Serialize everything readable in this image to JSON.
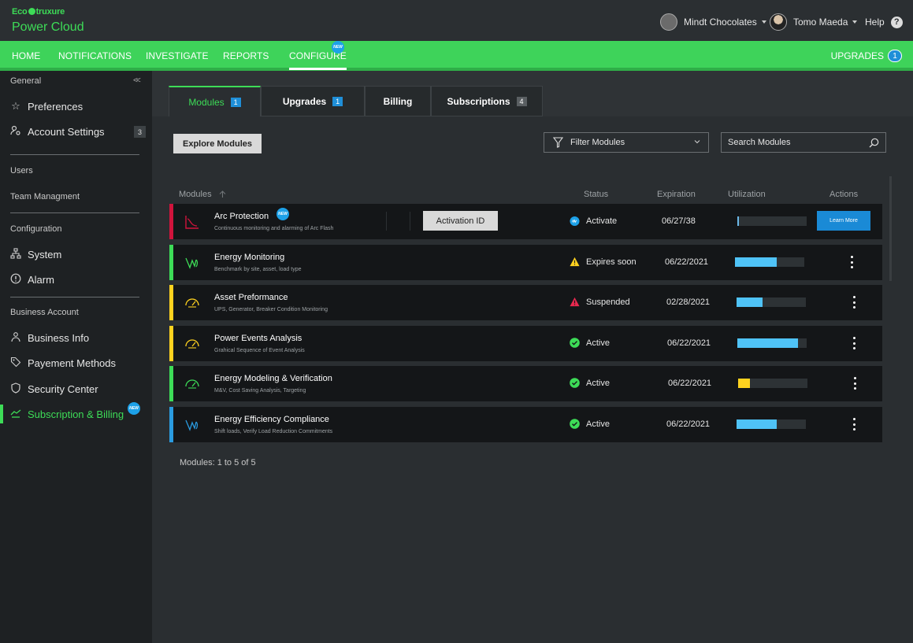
{
  "brand": {
    "eco_prefix": "Eco",
    "eco_suffix": "truxure",
    "title": "Power Cloud"
  },
  "header": {
    "account": "Mindt Chocolates",
    "user": "Tomo Maeda",
    "help": "Help",
    "help_glyph": "?"
  },
  "nav": {
    "items": [
      "HOME",
      "NOTIFICATIONS",
      "INVESTIGATE",
      "REPORTS",
      "CONFIGURE"
    ],
    "active": "CONFIGURE",
    "new_badge": "NEW",
    "upgrades_label": "UPGRADES",
    "upgrades_count": "1"
  },
  "sidebar": {
    "sections": [
      "General",
      "Users",
      "Team Managment",
      "Configuration",
      "Business Account"
    ],
    "items": {
      "preferences": "Preferences",
      "account_settings": "Account Settings",
      "account_settings_count": "3",
      "system": "System",
      "alarm": "Alarm",
      "business_info": "Business Info",
      "payment_methods": "Payement Methods",
      "security_center": "Security Center",
      "subscription_billing": "Subscription & Billing"
    },
    "new_badge": "NEW"
  },
  "tabs": [
    {
      "label": "Modules",
      "count": "1"
    },
    {
      "label": "Upgrades",
      "count": "1"
    },
    {
      "label": "Billing",
      "count": ""
    },
    {
      "label": "Subscriptions",
      "count": "4"
    }
  ],
  "toolbar": {
    "explore": "Explore Modules",
    "filter": "Filter Modules",
    "search_placeholder": "Search Modules"
  },
  "columns": {
    "modules": "Modules",
    "status": "Status",
    "expiration": "Expiration",
    "utilization": "Utilization",
    "actions": "Actions"
  },
  "rows": [
    {
      "title": "Arc Protection",
      "subtitle": "Continuous monitoring and alarming of Arc Flash",
      "status": "Activate",
      "expiration": "06/27/38",
      "utilization": 0.01,
      "stripe": "#d0143c",
      "activation_label": "Activation ID",
      "learn_label": "Learn More",
      "new_badge": "NEW"
    },
    {
      "title": "Energy Monitoring",
      "subtitle": "Benchmark by site, asset, load type",
      "status": "Expires soon",
      "expiration": "06/22/2021",
      "utilization": 0.6,
      "stripe": "#3ddc57"
    },
    {
      "title": "Asset Preformance",
      "subtitle": "UPS, Generator, Breaker Condition Monitoring",
      "status": "Suspended",
      "expiration": "02/28/2021",
      "utilization": 0.38,
      "stripe": "#ffd21f"
    },
    {
      "title": "Power Events Analysis",
      "subtitle": "Grahical Sequence of Event Analysis",
      "status": "Active",
      "expiration": "06/22/2021",
      "utilization": 0.87,
      "stripe": "#ffd21f"
    },
    {
      "title": "Energy Modeling & Verification",
      "subtitle": "M&V, Cost Saving Analysis, Targeting",
      "status": "Active",
      "expiration": "06/22/2021",
      "utilization": 0.17,
      "stripe": "#3ddc57"
    },
    {
      "title": "Energy Efficiency Compliance",
      "subtitle": "Shift loads, Verify Load Reduction Commitments",
      "status": "Active",
      "expiration": "06/22/2021",
      "utilization": 0.58,
      "stripe": "#2a9be0"
    }
  ],
  "footer": {
    "count_text": "Modules: 1 to 5 of 5"
  },
  "colors": {
    "accent": "#3ddc57",
    "blue": "#1f8fd8",
    "util_blue": "#4fc3f7",
    "util_yellow": "#ffd21f"
  }
}
